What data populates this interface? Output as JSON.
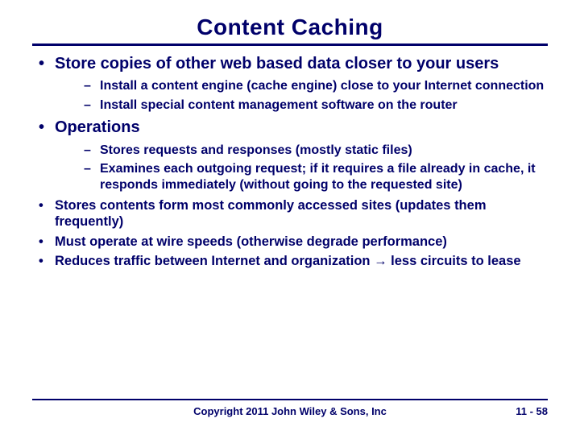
{
  "title": "Content Caching",
  "bullets": {
    "b1": "Store copies of other web based data closer to your users",
    "b1_subs": {
      "s1": "Install a content engine (cache engine) close to your Internet connection",
      "s2": "Install special content management software on the router"
    },
    "b2": "Operations",
    "b2_subs": {
      "s1": "Stores requests and responses (mostly static files)",
      "s2": "Examines each outgoing request; if it requires a file already in cache, it responds immediately (without going to the requested site)"
    },
    "b3": "Stores contents form most commonly accessed sites (updates them frequently)",
    "b4": "Must operate at wire speeds (otherwise degrade performance)",
    "b5": "Reduces traffic between Internet and organization → less circuits to lease"
  },
  "footer": {
    "copyright": "Copyright 2011 John Wiley & Sons, Inc",
    "page": "11  - 58"
  }
}
